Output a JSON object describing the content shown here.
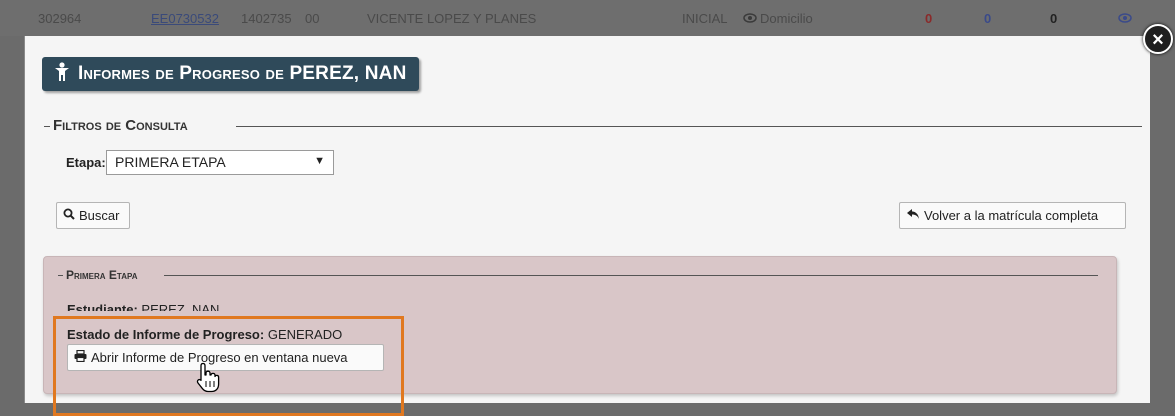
{
  "background_row": {
    "id": "302964",
    "code": "EE0730532",
    "number": "1402735",
    "section": "00",
    "school": "VICENTE LOPEZ Y PLANES",
    "level": "INICIAL",
    "scope_icon": "eye-icon",
    "scope": "Domicilio",
    "count_red": "0",
    "count_blue": "0",
    "count_black": "0"
  },
  "modal": {
    "title_icon": "student-icon",
    "title": "Informes de Progreso de PEREZ, NAN",
    "close_label": "×",
    "filters_legend": "Filtros de Consulta",
    "etapa_label": "Etapa:",
    "etapa_value": "PRIMERA ETAPA",
    "search_icon": "magnifier-icon",
    "search_label": "Buscar",
    "back_icon": "reply-arrow-icon",
    "back_label": "Volver a la matrícula completa",
    "section": {
      "legend": "Primera Etapa",
      "student_label": "Estudiante:",
      "student_value": "PEREZ, NAN",
      "status_label": "Estado de Informe de Progreso:",
      "status_value": "GENERADO",
      "open_icon": "printer-icon",
      "open_label": "Abrir Informe de Progreso en ventana nueva"
    }
  },
  "colors": {
    "banner": "#2f4a5a",
    "section_bg": "#d9c6c8",
    "highlight": "#e07820",
    "overlay": "#6b6b6b"
  }
}
